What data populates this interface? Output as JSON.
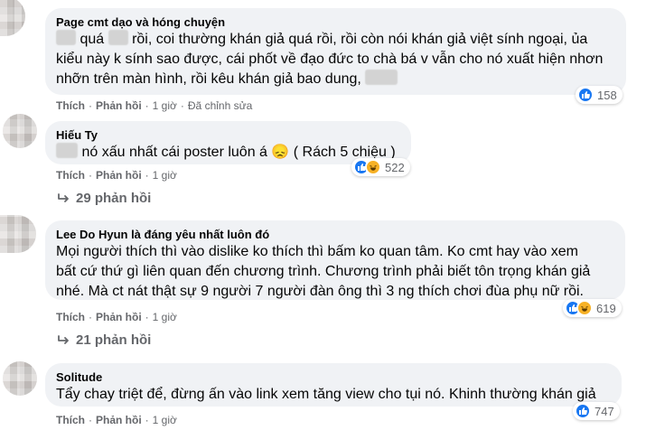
{
  "comments": [
    {
      "author": "Page cmt dạo và hóng chuyện",
      "line1_w1": "quá",
      "line1_rest": "rồi, coi thường khán giả quá rồi, rồi còn nói khán giả việt sính ngoại, ủa",
      "line2": "kiểu này k sính sao được, cái phốt về đạo đức to chà bá v vẫn cho nó xuất hiện nhơn",
      "line3": "nhỡn trên màn hình, rồi kêu khán giả bao dung,",
      "actions": {
        "like": "Thích",
        "reply": "Phản hồi",
        "time": "1 giờ",
        "edited": "Đã chỉnh sửa"
      },
      "reaction_count": "158",
      "reactions": [
        "like-icon"
      ]
    },
    {
      "author": "Hiếu Ty",
      "text": "nó xấu nhất cái poster luôn á 😞 ( Rách 5 chiệu )",
      "actions": {
        "like": "Thích",
        "reply": "Phản hồi",
        "time": "1 giờ"
      },
      "reaction_count": "522",
      "reactions": [
        "like-icon",
        "haha-icon"
      ],
      "replies": "29 phản hồi"
    },
    {
      "author": "Lee Do Hyun là đáng yêu nhất luôn đó",
      "line1": "Mọi người thích thì vào dislike ko thích thì bấm ko quan tâm. Ko cmt hay vào xem",
      "line2": "bất cứ thứ gì liên quan đến chương trình. Chương trình phải biết tôn trọng khán giả",
      "line3": "nhé. Mà ct nát thật sự 9 người 7 người đàn ông thì 3 ng thích chơi đùa phụ nữ rồi.",
      "actions": {
        "like": "Thích",
        "reply": "Phản hồi",
        "time": "1 giờ"
      },
      "reaction_count": "619",
      "reactions": [
        "like-icon",
        "haha-icon"
      ],
      "replies": "21 phản hồi"
    },
    {
      "author": "Solitude",
      "text": "Tẩy chay triệt để, đừng ấn vào link xem tăng view cho tụi nó. Khinh thường khán giả",
      "actions": {
        "like": "Thích",
        "reply": "Phản hồi",
        "time": "1 giờ"
      },
      "reaction_count": "747",
      "reactions": [
        "like-icon"
      ]
    }
  ],
  "colors": {
    "bubble": "#f0f2f5",
    "like": "#1877f2",
    "haha": "#f7b125",
    "secondary_text": "#65676b"
  }
}
